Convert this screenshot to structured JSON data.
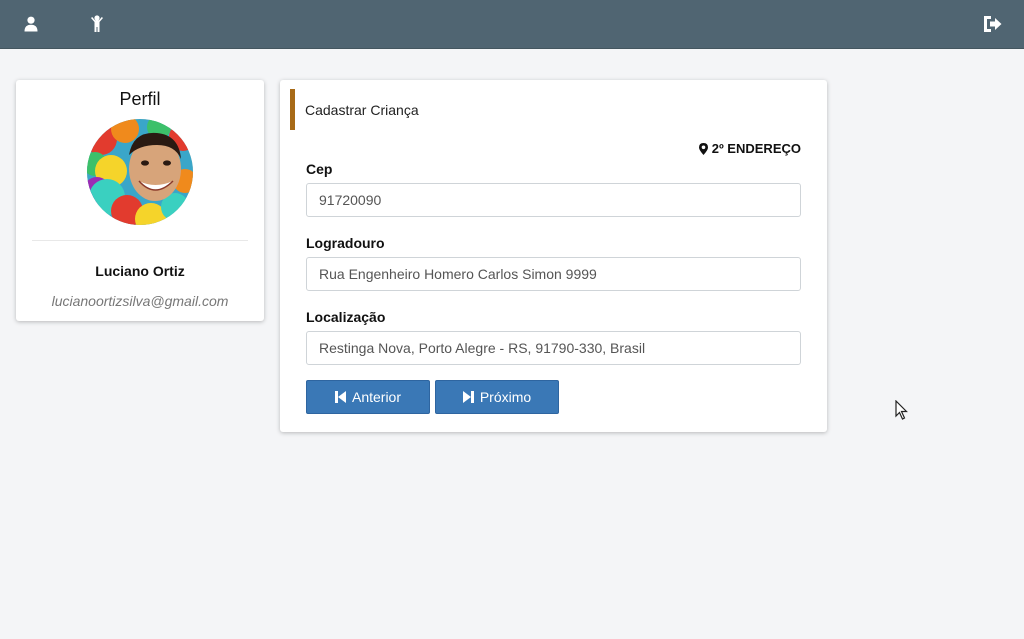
{
  "topbar": {
    "icons": [
      "user-icon",
      "child-icon",
      "sign-out-icon"
    ],
    "color": "#506572"
  },
  "profile": {
    "title": "Perfil",
    "name": "Luciano Ortiz",
    "email": "lucianoortizsilva@gmail.com"
  },
  "form": {
    "title": "Cadastrar Criança",
    "accent": "#a86a17",
    "address_tag": "2º ENDEREÇO",
    "fields": [
      {
        "label": "Cep",
        "value": "91720090"
      },
      {
        "label": "Logradouro",
        "value": "Rua Engenheiro Homero Carlos Simon 9999"
      },
      {
        "label": "Localização",
        "value": "Restinga Nova, Porto Alegre - RS, 91790-330, Brasil"
      }
    ],
    "buttons": {
      "previous": "Anterior",
      "next": "Próximo",
      "color": "#3a78b6"
    }
  }
}
